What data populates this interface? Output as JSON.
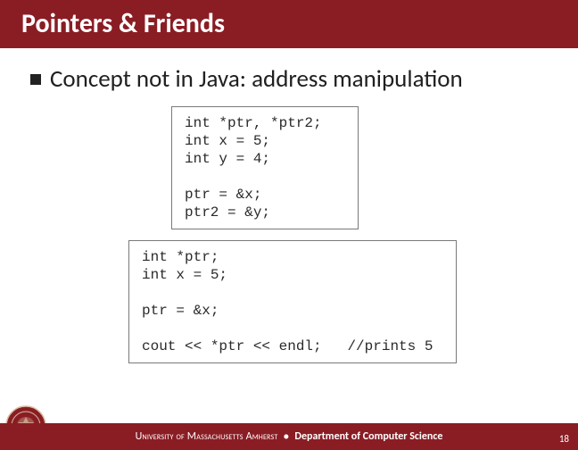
{
  "title": "Pointers & Friends",
  "bullet": "Concept not in Java: address manipulation",
  "code1": "int *ptr, *ptr2;\nint x = 5;\nint y = 4;\n\nptr = &x;\nptr2 = &y;",
  "code2": "int *ptr;\nint x = 5;\n\nptr = &x;\n\ncout << *ptr << endl;   //prints 5",
  "footer": {
    "university": "University of Massachusetts Amherst",
    "separator": "•",
    "department": "Department of Computer Science"
  },
  "page_number": "18"
}
